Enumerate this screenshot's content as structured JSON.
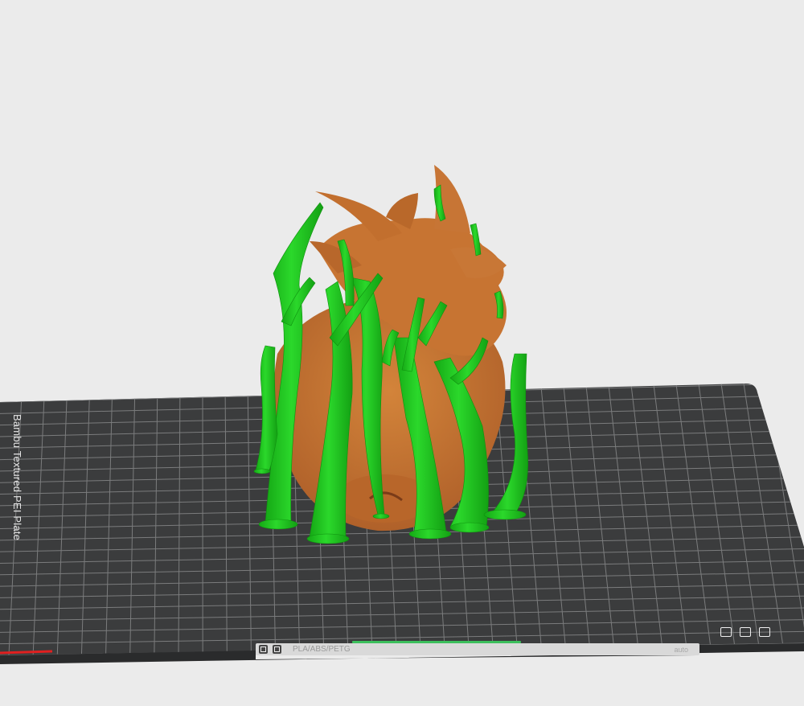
{
  "plate": {
    "label": "Bambu Textured PEI Plate",
    "plate_name": "PLA/ABS/PETG",
    "status_text": "auto",
    "colors": {
      "background": "#ebebeb",
      "plate": "#3b3c3d",
      "grid": "#8a8b8c",
      "model": "#c8742f",
      "support": "#1ac41a",
      "axis_x": "#e02020"
    }
  },
  "icons": [
    "arrange-icon",
    "orient-icon",
    "lock-icon",
    "settings-icon",
    "edit-icon"
  ]
}
